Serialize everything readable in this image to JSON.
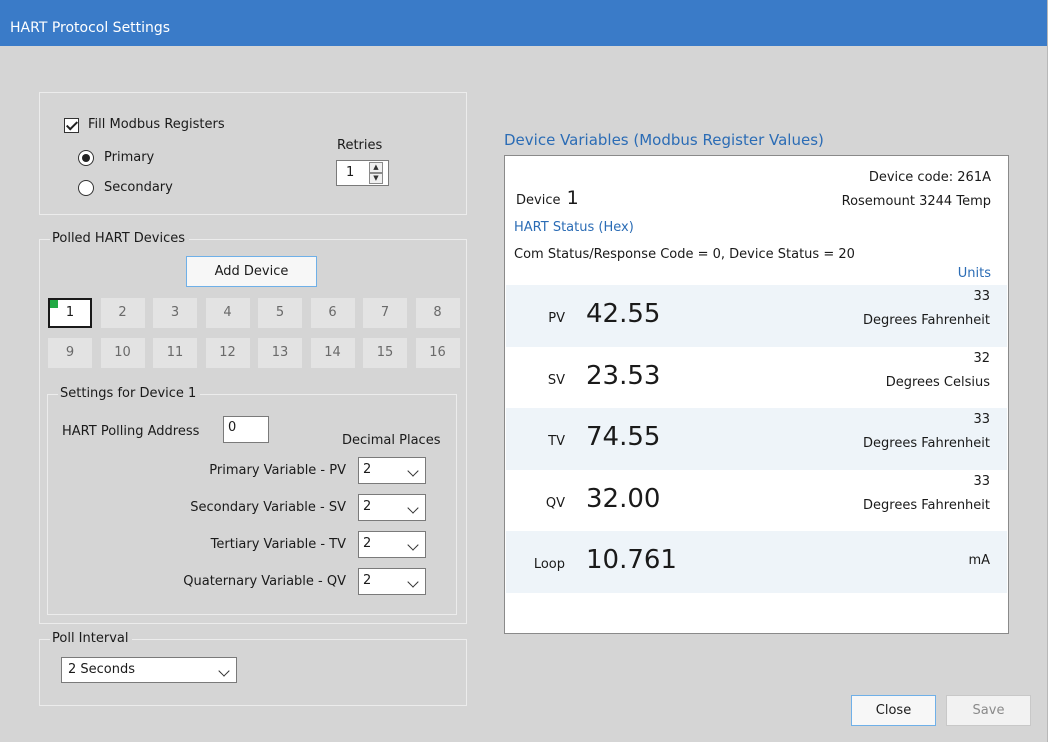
{
  "window": {
    "title": "HART Protocol Settings"
  },
  "modbus": {
    "fill_label": "Fill Modbus Registers",
    "fill_checked": true,
    "primary_label": "Primary",
    "secondary_label": "Secondary",
    "selected": "Primary",
    "retries_label": "Retries",
    "retries_value": "1"
  },
  "polled": {
    "legend": "Polled HART Devices",
    "add_device_label": "Add Device",
    "devices": [
      "1",
      "2",
      "3",
      "4",
      "5",
      "6",
      "7",
      "8",
      "9",
      "10",
      "11",
      "12",
      "13",
      "14",
      "15",
      "16"
    ],
    "selected_device": "1"
  },
  "settings": {
    "legend": "Settings for Device 1",
    "polling_address_label": "HART Polling Address",
    "polling_address_value": "0",
    "decimal_places_label": "Decimal Places",
    "rows": [
      {
        "label": "Primary Variable - PV",
        "value": "2"
      },
      {
        "label": "Secondary Variable - SV",
        "value": "2"
      },
      {
        "label": "Tertiary Variable - TV",
        "value": "2"
      },
      {
        "label": "Quaternary Variable - QV",
        "value": "2"
      }
    ]
  },
  "poll_interval": {
    "legend": "Poll Interval",
    "value": "2 Seconds"
  },
  "device_vars": {
    "heading": "Device Variables (Modbus Register Values)",
    "device_code": "Device code: 261A",
    "device_word": "Device",
    "device_number": "1",
    "model": "Rosemount 3244 Temp",
    "hart_status_label": "HART Status (Hex)",
    "status_line": "Com Status/Response Code = 0, Device Status = 20",
    "units_label": "Units",
    "variables": [
      {
        "name": "PV",
        "value": "42.55",
        "unit_code": "33",
        "unit_name": "Degrees Fahrenheit"
      },
      {
        "name": "SV",
        "value": "23.53",
        "unit_code": "32",
        "unit_name": "Degrees Celsius"
      },
      {
        "name": "TV",
        "value": "74.55",
        "unit_code": "33",
        "unit_name": "Degrees Fahrenheit"
      },
      {
        "name": "QV",
        "value": "32.00",
        "unit_code": "33",
        "unit_name": "Degrees Fahrenheit"
      },
      {
        "name": "Loop",
        "value": "10.761",
        "unit_code": "",
        "unit_name": "mA"
      }
    ]
  },
  "footer": {
    "close_label": "Close",
    "save_label": "Save"
  },
  "colors": {
    "titlebar": "#3a7bc8",
    "accent_blue": "#2b6cb5",
    "active_device": "#22aa44",
    "row_shade": "#eef4f9"
  }
}
